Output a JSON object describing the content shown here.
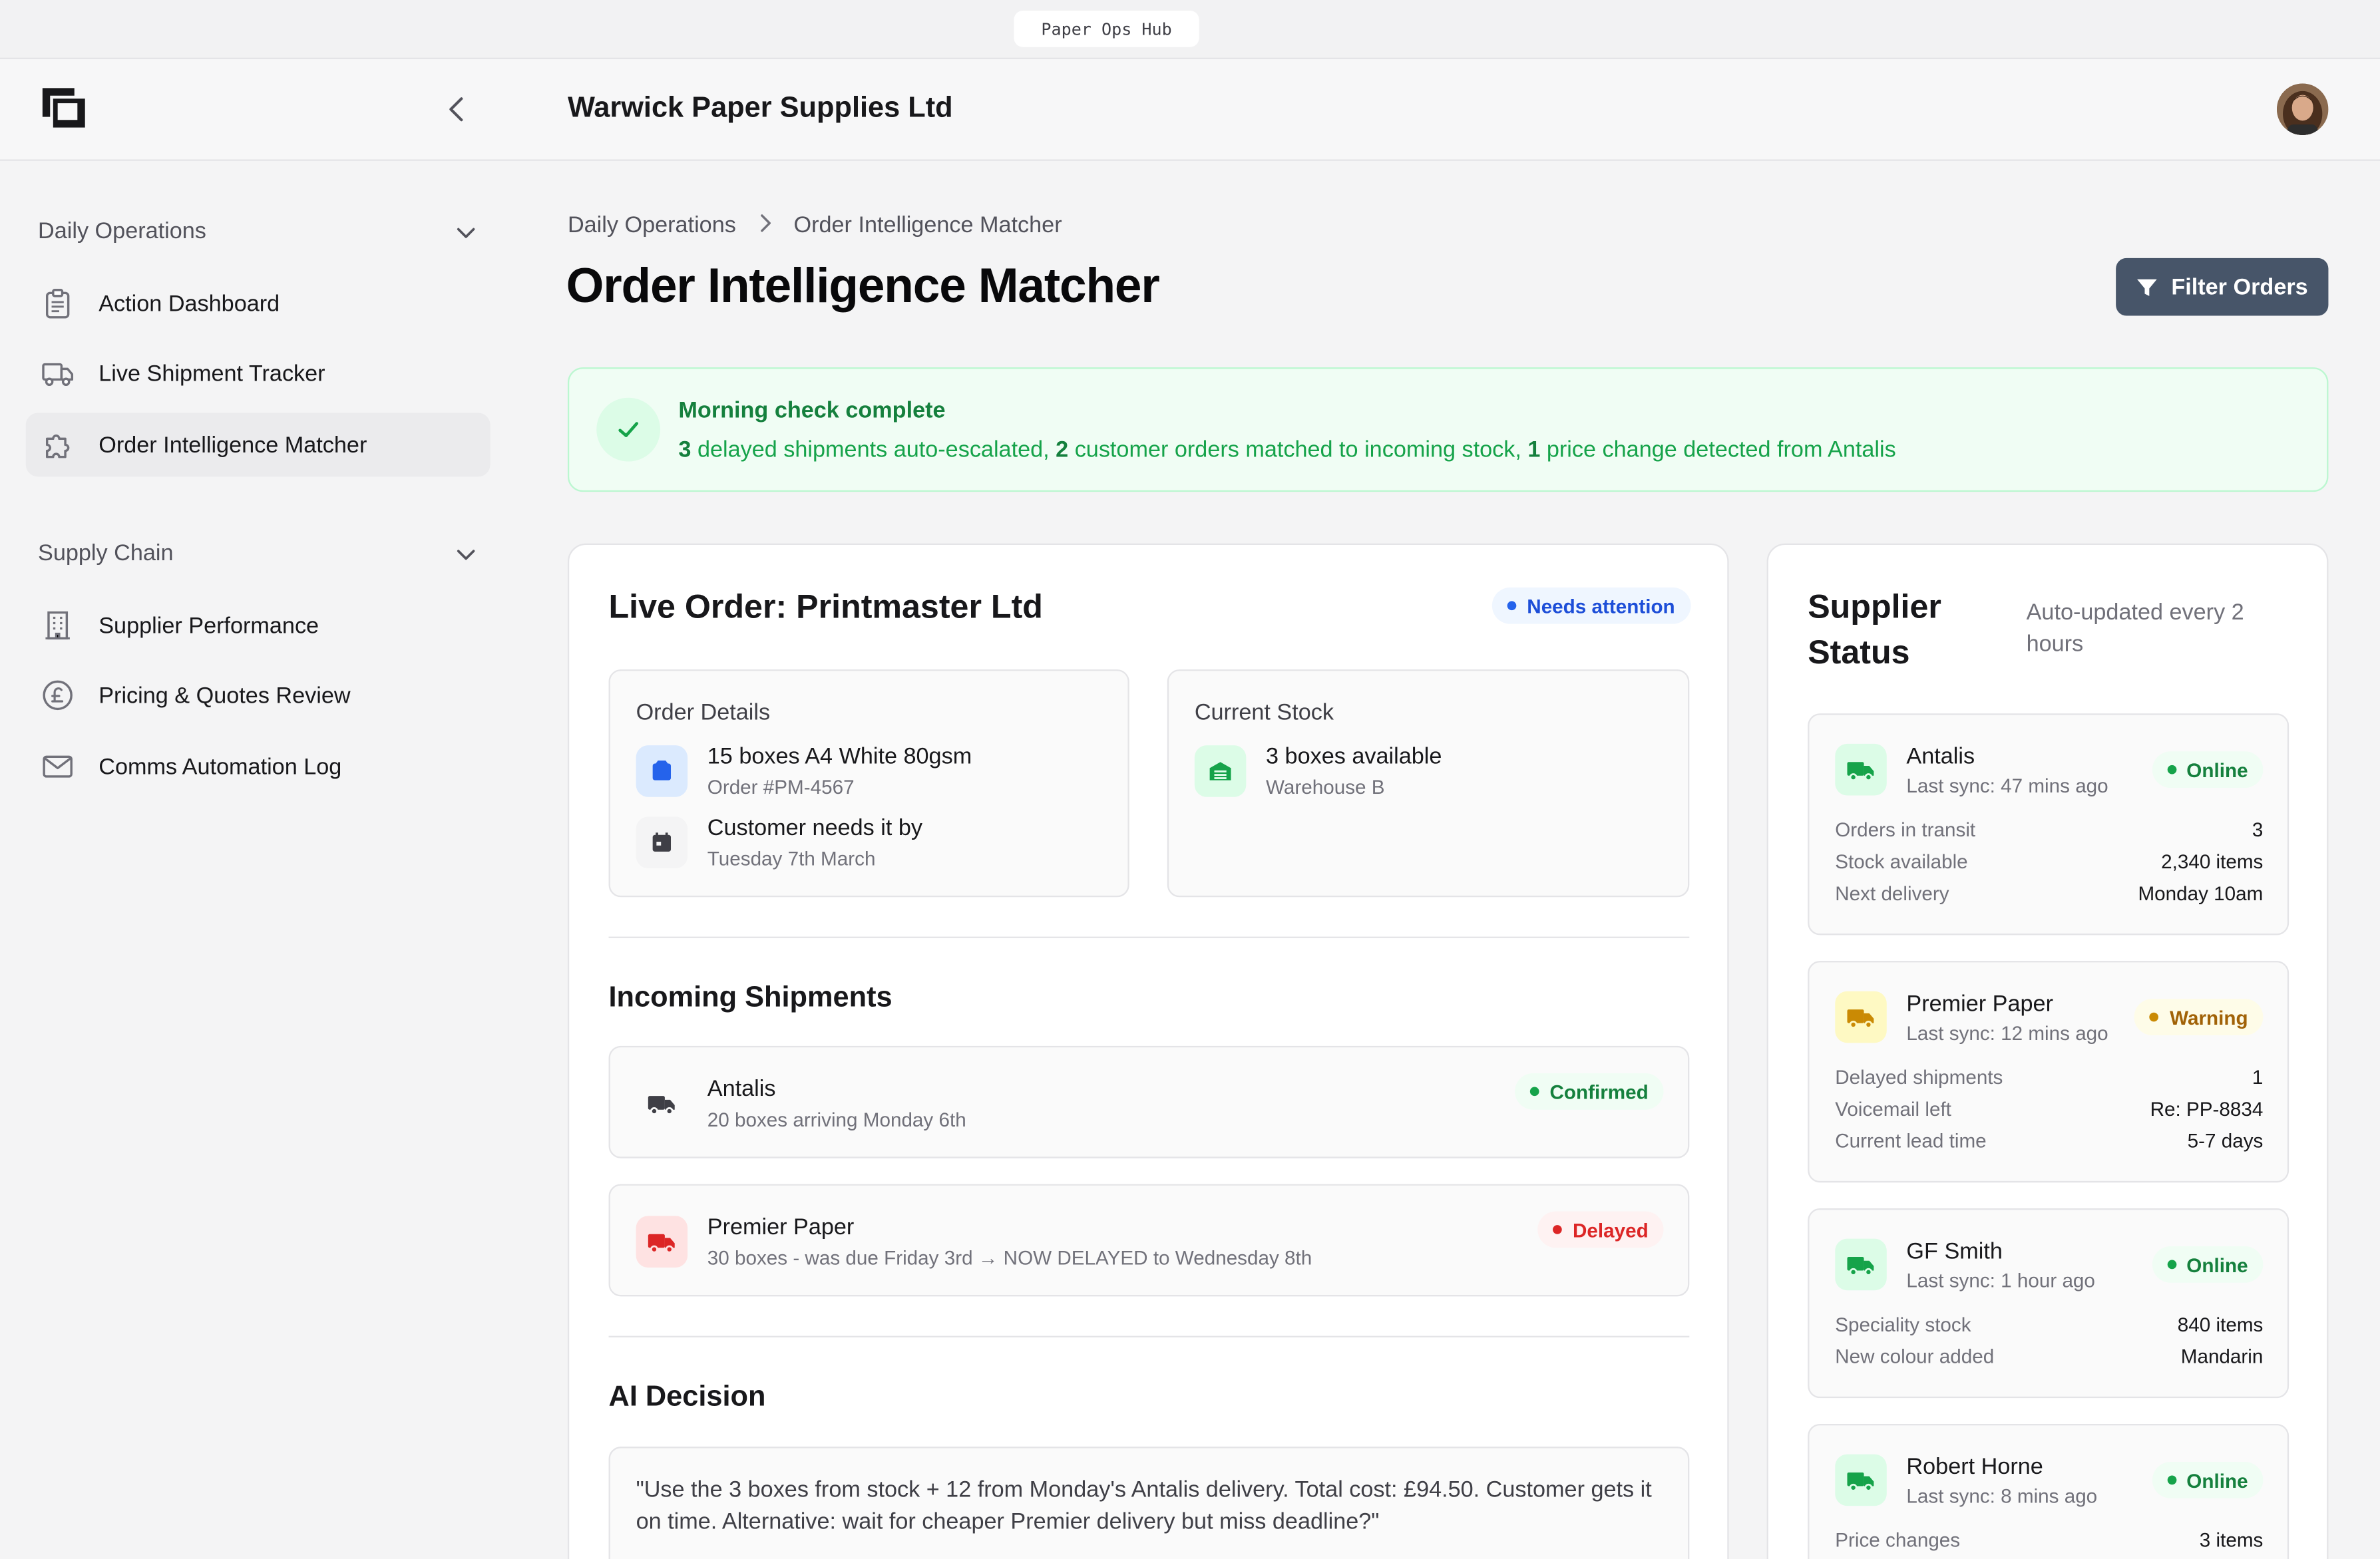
{
  "topbar": {
    "app_label": "Paper Ops Hub"
  },
  "header": {
    "company": "Warwick Paper Supplies Ltd"
  },
  "sidebar": {
    "sections": [
      {
        "title": "Daily Operations",
        "items": [
          {
            "label": "Action Dashboard",
            "icon": "clipboard-icon"
          },
          {
            "label": "Live Shipment Tracker",
            "icon": "truck-icon"
          },
          {
            "label": "Order Intelligence Matcher",
            "icon": "puzzle-icon",
            "active": true
          }
        ]
      },
      {
        "title": "Supply Chain",
        "items": [
          {
            "label": "Supplier Performance",
            "icon": "building-icon"
          },
          {
            "label": "Pricing & Quotes Review",
            "icon": "pound-icon"
          },
          {
            "label": "Comms Automation Log",
            "icon": "mail-icon"
          }
        ]
      }
    ]
  },
  "breadcrumb": {
    "parent": "Daily Operations",
    "current": "Order Intelligence Matcher"
  },
  "page": {
    "title": "Order Intelligence Matcher",
    "filter_label": "Filter Orders"
  },
  "banner": {
    "title": "Morning check complete",
    "n1": "3",
    "t1": " delayed shipments auto-escalated, ",
    "n2": "2",
    "t2": " customer orders matched to incoming stock, ",
    "n3": "1",
    "t3": " price change detected from Antalis"
  },
  "order": {
    "title": "Live Order: Printmaster Ltd",
    "status": "Needs attention",
    "details_label": "Order Details",
    "product": "15 boxes A4 White 80gsm",
    "order_no": "Order #PM-4567",
    "needs_by_label": "Customer needs it by",
    "needs_by": "Tuesday 7th March",
    "stock_label": "Current Stock",
    "stock_value": "3 boxes available",
    "stock_location": "Warehouse B"
  },
  "incoming": {
    "title": "Incoming Shipments",
    "items": [
      {
        "supplier": "Antalis",
        "detail": "20 boxes arriving Monday 6th",
        "status": "Confirmed"
      },
      {
        "supplier": "Premier Paper",
        "detail": "30 boxes - was due Friday 3rd → NOW DELAYED to Wednesday 8th",
        "status": "Delayed"
      }
    ]
  },
  "ai": {
    "title": "AI Decision",
    "text": "\"Use the 3 boxes from stock + 12 from Monday's Antalis delivery. Total cost: £94.50. Customer gets it on time. Alternative: wait for cheaper Premier delivery but miss deadline?\""
  },
  "suppliers": {
    "title": "Supplier Status",
    "subtitle": "Auto-updated every 2 hours",
    "items": [
      {
        "name": "Antalis",
        "sync": "Last sync: 47 mins ago",
        "status": "Online",
        "stats": [
          {
            "k": "Orders in transit",
            "v": "3"
          },
          {
            "k": "Stock available",
            "v": "2,340 items"
          },
          {
            "k": "Next delivery",
            "v": "Monday 10am"
          }
        ]
      },
      {
        "name": "Premier Paper",
        "sync": "Last sync: 12 mins ago",
        "status": "Warning",
        "stats": [
          {
            "k": "Delayed shipments",
            "v": "1"
          },
          {
            "k": "Voicemail left",
            "v": "Re: PP-8834"
          },
          {
            "k": "Current lead time",
            "v": "5-7 days"
          }
        ]
      },
      {
        "name": "GF Smith",
        "sync": "Last sync: 1 hour ago",
        "status": "Online",
        "stats": [
          {
            "k": "Speciality stock",
            "v": "840 items"
          },
          {
            "k": "New colour added",
            "v": "Mandarin"
          }
        ]
      },
      {
        "name": "Robert Horne",
        "sync": "Last sync: 8 mins ago",
        "status": "Online",
        "stats": [
          {
            "k": "Price changes",
            "v": "3 items"
          }
        ]
      }
    ]
  },
  "colors": {
    "success": "#16a34a",
    "danger": "#dc2626",
    "warning": "#ca8a04",
    "info": "#1d4ed8",
    "primary_button": "#475569"
  }
}
